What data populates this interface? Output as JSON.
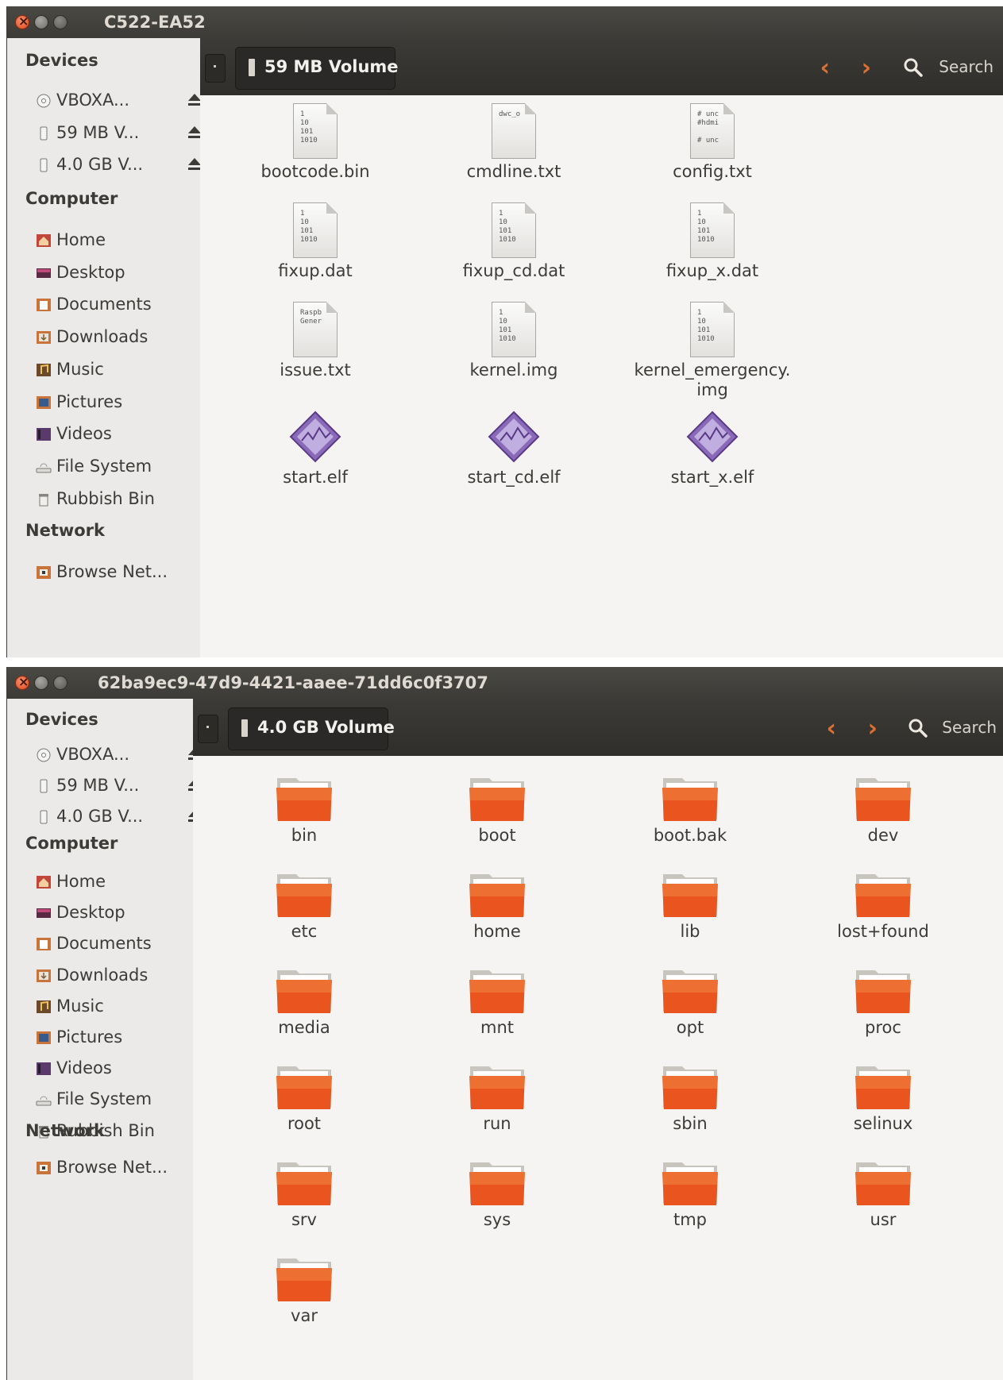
{
  "window1": {
    "title": "C522-EA52",
    "breadcrumb": "59 MB Volume",
    "search_label": "Search",
    "sidebar": {
      "devices_header": "Devices",
      "devices": [
        "VBOXA...",
        "59 MB V...",
        "4.0 GB V..."
      ],
      "computer_header": "Computer",
      "places": [
        {
          "label": "Home",
          "icon": "home-icon"
        },
        {
          "label": "Desktop",
          "icon": "desktop-icon"
        },
        {
          "label": "Documents",
          "icon": "documents-icon"
        },
        {
          "label": "Downloads",
          "icon": "downloads-icon"
        },
        {
          "label": "Music",
          "icon": "music-icon"
        },
        {
          "label": "Pictures",
          "icon": "pictures-icon"
        },
        {
          "label": "Videos",
          "icon": "videos-icon"
        },
        {
          "label": "File System",
          "icon": "filesystem-icon"
        },
        {
          "label": "Rubbish Bin",
          "icon": "trash-icon"
        }
      ],
      "network_header": "Network",
      "network": [
        "Browse Net..."
      ]
    },
    "files": [
      {
        "name": "bootcode.bin",
        "kind": "binary",
        "preview": "1\n10\n101\n1010"
      },
      {
        "name": "cmdline.txt",
        "kind": "text",
        "preview": "dwc_o"
      },
      {
        "name": "config.txt",
        "kind": "text",
        "preview": "# unc\n#hdmi\n\n# unc"
      },
      {
        "name": "fixup.dat",
        "kind": "binary",
        "preview": "1\n10\n101\n1010"
      },
      {
        "name": "fixup_cd.dat",
        "kind": "binary",
        "preview": "1\n10\n101\n1010"
      },
      {
        "name": "fixup_x.dat",
        "kind": "binary",
        "preview": "1\n10\n101\n1010"
      },
      {
        "name": "issue.txt",
        "kind": "text",
        "preview": "Raspb\nGener"
      },
      {
        "name": "kernel.img",
        "kind": "binary",
        "preview": "1\n10\n101\n1010"
      },
      {
        "name": "kernel_emergency.\nimg",
        "kind": "binary",
        "preview": "1\n10\n101\n1010"
      },
      {
        "name": "start.elf",
        "kind": "elf",
        "preview": ""
      },
      {
        "name": "start_cd.elf",
        "kind": "elf",
        "preview": ""
      },
      {
        "name": "start_x.elf",
        "kind": "elf",
        "preview": ""
      }
    ]
  },
  "window2": {
    "title": "62ba9ec9-47d9-4421-aaee-71dd6c0f3707",
    "breadcrumb": "4.0 GB Volume",
    "search_label": "Search",
    "sidebar": {
      "devices_header": "Devices",
      "devices": [
        "VBOXA...",
        "59 MB V...",
        "4.0 GB V..."
      ],
      "computer_header": "Computer",
      "places": [
        {
          "label": "Home",
          "icon": "home-icon"
        },
        {
          "label": "Desktop",
          "icon": "desktop-icon"
        },
        {
          "label": "Documents",
          "icon": "documents-icon"
        },
        {
          "label": "Downloads",
          "icon": "downloads-icon"
        },
        {
          "label": "Music",
          "icon": "music-icon"
        },
        {
          "label": "Pictures",
          "icon": "pictures-icon"
        },
        {
          "label": "Videos",
          "icon": "videos-icon"
        },
        {
          "label": "File System",
          "icon": "filesystem-icon"
        },
        {
          "label": "Rubbish Bin",
          "icon": "trash-icon"
        }
      ],
      "network_header": "Network",
      "network": [
        "Browse Net..."
      ]
    },
    "folders": [
      "bin",
      "boot",
      "boot.bak",
      "dev",
      "etc",
      "home",
      "lib",
      "lost+found",
      "media",
      "mnt",
      "opt",
      "proc",
      "root",
      "run",
      "sbin",
      "selinux",
      "srv",
      "sys",
      "tmp",
      "usr",
      "var"
    ]
  },
  "colors": {
    "accent_orange": "#e0702e",
    "folder_orange": "#e9541f",
    "titlebar": "#3c3b37",
    "sidebar_bg": "#ebeae8",
    "content_bg": "#f5f4f2"
  }
}
